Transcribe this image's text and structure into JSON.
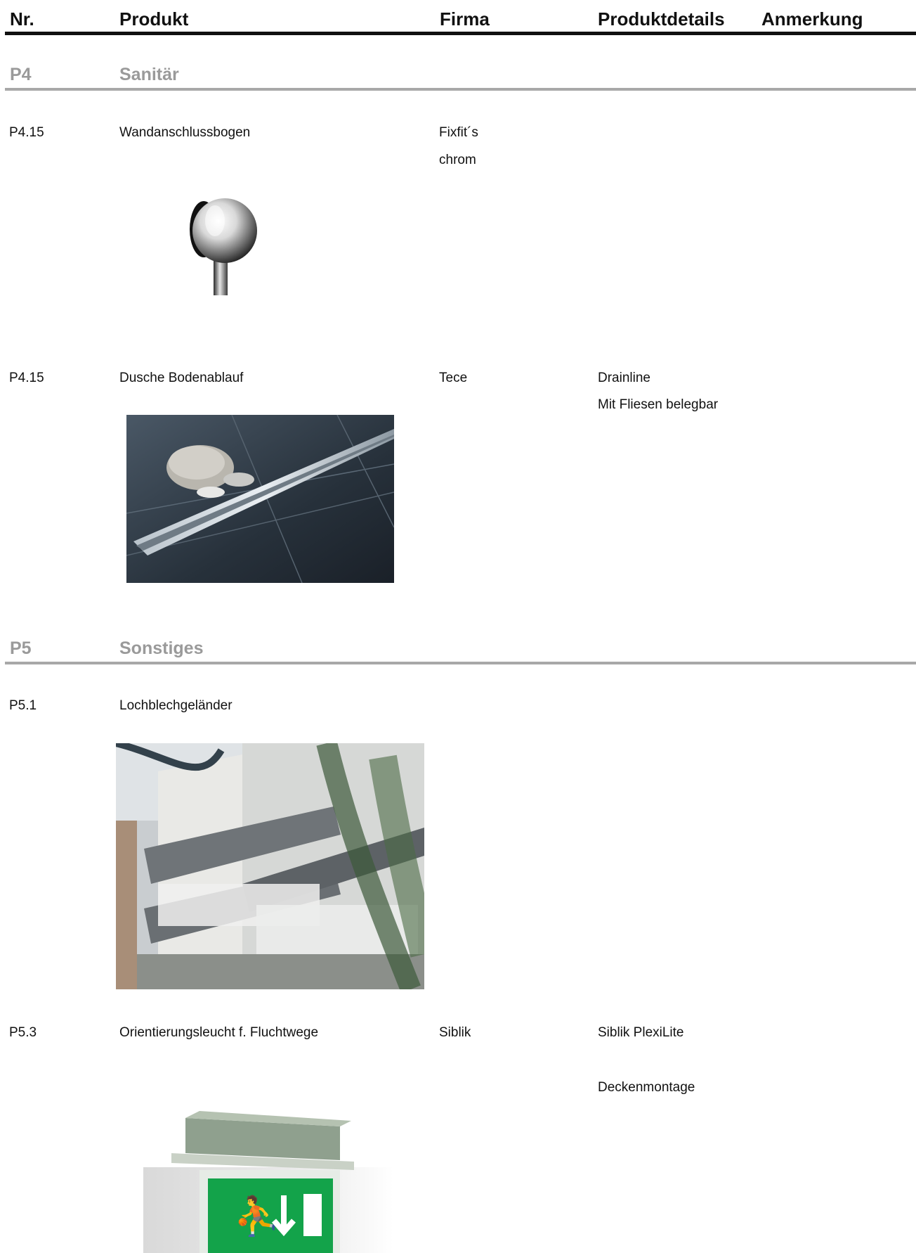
{
  "header": {
    "nr": "Nr.",
    "produkt": "Produkt",
    "firma": "Firma",
    "produktdetails": "Produktdetails",
    "anmerkung": "Anmerkung"
  },
  "sections": [
    {
      "nr": "P4",
      "title": "Sanitär"
    },
    {
      "nr": "P5",
      "title": "Sonstiges"
    }
  ],
  "items": [
    {
      "nr": "P4.15",
      "produkt": "Wandanschlussbogen",
      "firma": [
        "Fixfit´s",
        "chrom"
      ],
      "details": [],
      "image": "wall-outlet-elbow-photo"
    },
    {
      "nr": "P4.15",
      "produkt": "Dusche Bodenablauf",
      "firma": [
        "Tece"
      ],
      "details": [
        "Drainline",
        "Mit Fliesen belegbar"
      ],
      "image": "shower-drain-photo"
    },
    {
      "nr": "P5.1",
      "produkt": "Lochblechgeländer",
      "firma": [],
      "details": [],
      "image": "perforated-railing-photo"
    },
    {
      "nr": "P5.3",
      "produkt": "Orientierungsleucht f. Fluchtwege",
      "firma": [
        "Siblik"
      ],
      "details": [
        "Siblik PlexiLite",
        "Deckenmontage"
      ],
      "image": "emergency-exit-light-photo"
    }
  ]
}
